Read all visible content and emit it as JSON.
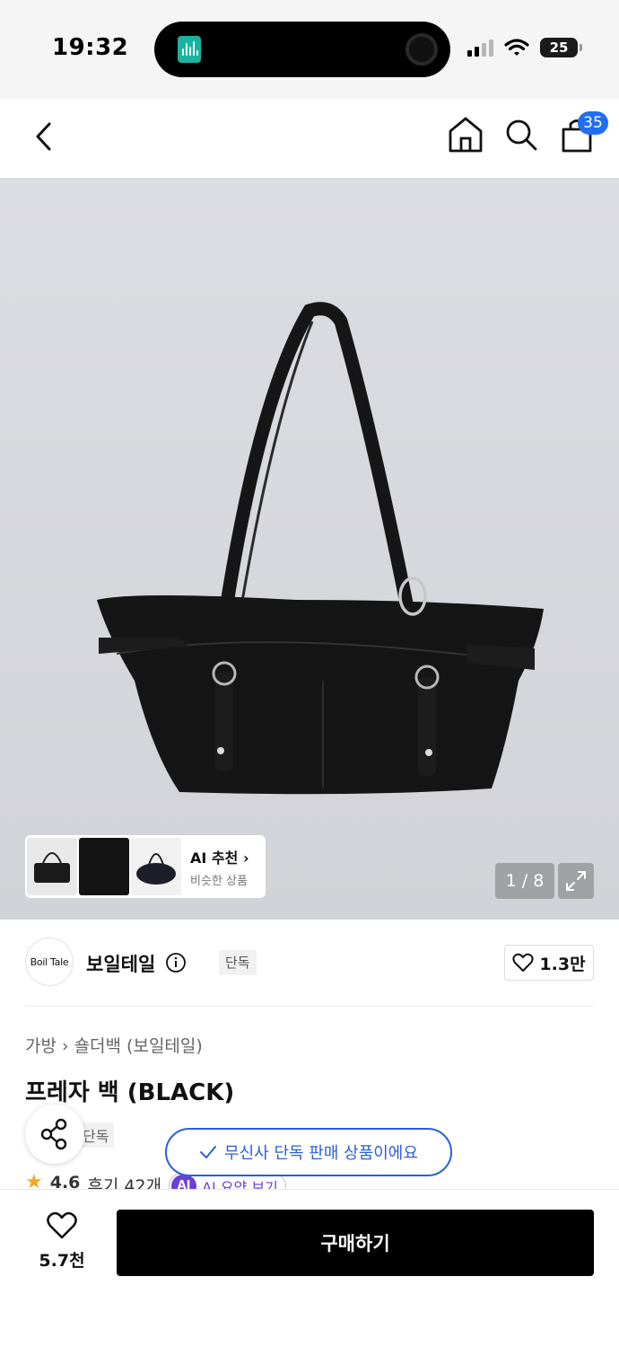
{
  "status_bar": {
    "time": "19:32",
    "battery": "25"
  },
  "header": {
    "cart_count": "35"
  },
  "image": {
    "counter": "1 / 8",
    "ai_reco_title": "AI 추천",
    "ai_reco_sub": "비슷한 상품"
  },
  "brand": {
    "logo_text": "Boil Tale",
    "name": "보일테일",
    "exclusive_tag": "단독",
    "likes": "1.3만"
  },
  "product": {
    "breadcrumb": [
      "가방",
      "숄더백 (보일테일)"
    ],
    "title": "프레자 백 (BLACK)",
    "badge": "단독"
  },
  "toast": "무신사 단독 판매 상품이에요",
  "rating": {
    "score": "4.6",
    "reviews": "후기 42개",
    "ai_label": "AI",
    "ai_summary": "AI 요약 보기"
  },
  "bottom": {
    "wish_count": "5.7천",
    "buy_label": "구매하기"
  },
  "colors": {
    "accent": "#1f6ef5",
    "toast": "#2b5fd9",
    "ai_purple": "#6b3fd6",
    "star": "#f5a623"
  }
}
